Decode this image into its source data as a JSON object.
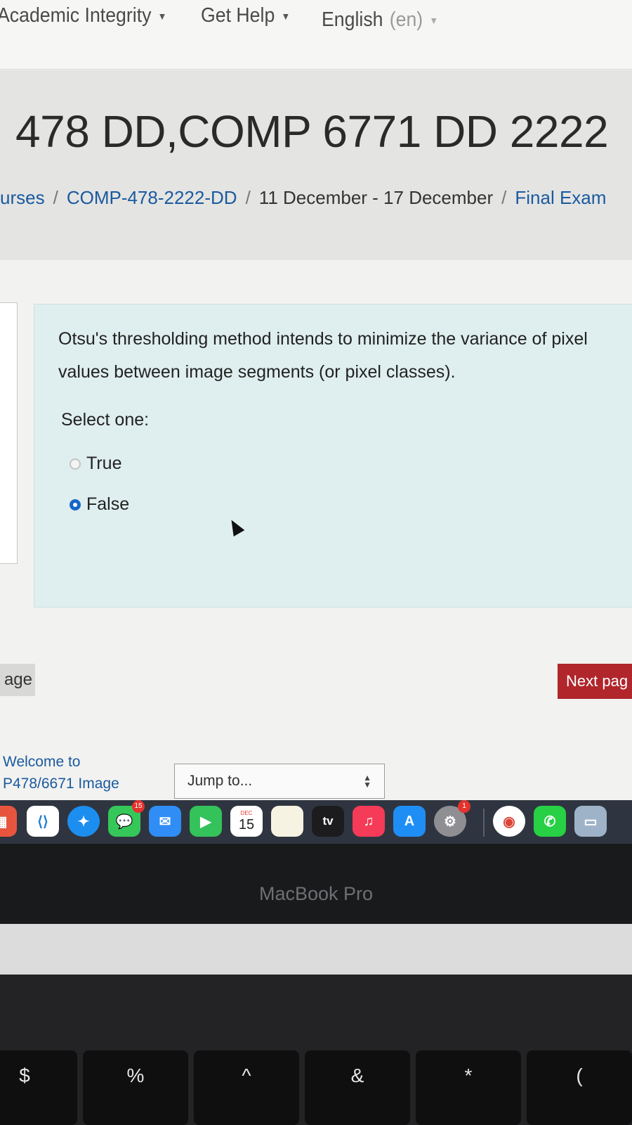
{
  "navbar": {
    "academic_integrity": "Academic Integrity",
    "get_help": "Get Help",
    "language": "English",
    "language_code": "(en)"
  },
  "header": {
    "course_title": "478 DD,COMP 6771 DD 2222",
    "breadcrumb": {
      "courses": "urses",
      "course": "COMP-478-2222-DD",
      "week": "11 December - 17 December",
      "quiz": "Final Exam"
    }
  },
  "question": {
    "text": "Otsu's thresholding method intends to minimize the variance of pixel values between image segments (or pixel classes).",
    "prompt": "Select one:",
    "options": [
      {
        "label": "True",
        "selected": false
      },
      {
        "label": "False",
        "selected": true
      }
    ]
  },
  "navigation": {
    "previous_label": "age",
    "next_label": "Next pag"
  },
  "footer": {
    "welcome_line1": "Welcome to",
    "welcome_line2": "P478/6671 Image",
    "jump_placeholder": "Jump to..."
  },
  "dock": {
    "items": [
      {
        "name": "launchpad-icon",
        "color": "#e8553f"
      },
      {
        "name": "vscode-icon",
        "color": "#1f7fd4"
      },
      {
        "name": "safari-icon",
        "color": "#1c8ef0"
      },
      {
        "name": "messages-icon",
        "color": "#35c759",
        "badge": "15"
      },
      {
        "name": "mail-icon",
        "color": "#2f8df5"
      },
      {
        "name": "facetime-icon",
        "color": "#34c25a"
      },
      {
        "name": "calendar-icon",
        "color": "#ffffff",
        "month": "DEC",
        "day": "15"
      },
      {
        "name": "notes-icon",
        "color": "#f7f3e3"
      },
      {
        "name": "apple-tv-icon",
        "color": "#1c1c1e",
        "label": "tv"
      },
      {
        "name": "music-icon",
        "color": "#f53b57"
      },
      {
        "name": "app-store-icon",
        "color": "#1e8ef5"
      },
      {
        "name": "system-settings-icon",
        "color": "#8e8e93",
        "badge": "1"
      },
      {
        "name": "chrome-icon",
        "color": "#ffffff"
      },
      {
        "name": "whatsapp-icon",
        "color": "#27d045"
      },
      {
        "name": "preview-icon",
        "color": "#9fb3c8"
      }
    ]
  },
  "laptop": {
    "model": "MacBook Pro",
    "keys": [
      "$",
      "%",
      "^",
      "&",
      "*",
      "("
    ]
  }
}
